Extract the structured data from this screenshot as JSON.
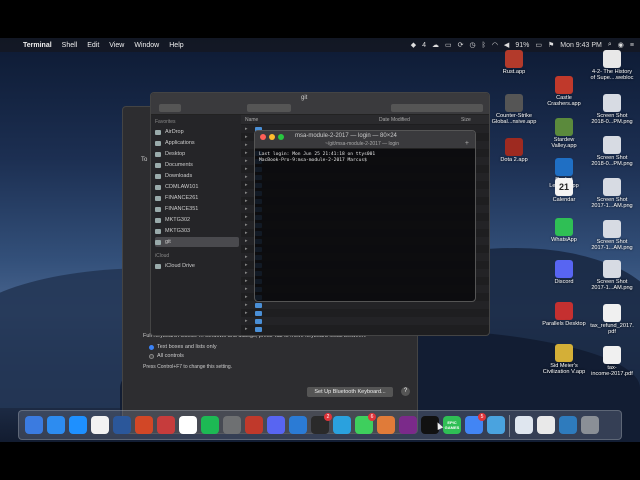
{
  "menubar": {
    "app": "Terminal",
    "items": [
      "Shell",
      "Edit",
      "View",
      "Window",
      "Help"
    ],
    "status": {
      "badge": "4",
      "battery": "91%",
      "clock": "Mon 9:43 PM"
    }
  },
  "finder": {
    "window_title": "git",
    "favorites_label": "Favorites",
    "sidebar": [
      "AirDrop",
      "Applications",
      "Desktop",
      "Documents",
      "Downloads",
      "CDMLAW101",
      "FINANCE261",
      "FINANCE351",
      "MKTG302",
      "MKTG303",
      "git"
    ],
    "icloud_label": "iCloud",
    "icloud_items": [
      "iCloud Drive"
    ],
    "columns": {
      "name": "Name",
      "date": "Date Modified",
      "size": "Size"
    }
  },
  "terminal": {
    "title": "msa-module-2-2017 — login — 80×24",
    "subtitle": "~/git/msa-module-2-2017 — login",
    "lines": [
      "Last login: Mon Jun 25 21:41:18 on ttys001",
      "MacBook-Pro-9:msa-module-2-2017 Marcus$ "
    ]
  },
  "keyboard_prefs": {
    "heading_fragment": "To",
    "full_keyboard_access": "Full Keyboard Access: In windows and dialogs, press Tab to move keyboard focus between:",
    "radio_text_boxes": "Text boxes and lists only",
    "radio_all_controls": "All controls",
    "hint": "Press Control+F7 to change this setting.",
    "bluetooth_button": "Set Up Bluetooth Keyboard...",
    "help_button": "?"
  },
  "desktop_icons": [
    {
      "label": "Rust.app",
      "color": "#b33a2b"
    },
    {
      "label": "4-2- The History\nof Supe....webloc",
      "color": "#e8e8e8"
    },
    {
      "label": "Castle\nCrashers.app",
      "color": "#c0392b"
    },
    {
      "label": "Counter-Strike\nGlobal...nsive.app",
      "color": "#555"
    },
    {
      "label": "Screen Shot\n2018-0...PM.png",
      "color": "#d7dbe3"
    },
    {
      "label": "Stardew\nValley.app",
      "color": "#5b8a3c"
    },
    {
      "label": "Dota 2.app",
      "color": "#9e2a20"
    },
    {
      "label": "Screen Shot\n2018-0...PM.png",
      "color": "#d7dbe3"
    },
    {
      "label": "Rocket\nLeague.app",
      "color": "#1f6fc4"
    },
    {
      "label": "Calendar",
      "color": "#f4f4f4"
    },
    {
      "label": "Screen Shot\n2017-1...AM.png",
      "color": "#d7dbe3"
    },
    {
      "label": "WhatsApp",
      "color": "#2fbf55"
    },
    {
      "label": "Screen Shot\n2017-1...AM.png",
      "color": "#d7dbe3"
    },
    {
      "label": "Discord",
      "color": "#5865f2"
    },
    {
      "label": "Screen Shot\n2017-1...AM.png",
      "color": "#d7dbe3"
    },
    {
      "label": "Parallels Desktop",
      "color": "#c53030"
    },
    {
      "label": "tax_refund_2017.\npdf",
      "color": "#f0f0f0"
    },
    {
      "label": "Sid Meier's\nCivilization V.app",
      "color": "#d4af37"
    },
    {
      "label": "tax-\nincome-2017.pdf",
      "color": "#f0f0f0"
    }
  ],
  "calendar_day": "21",
  "dock_badges": [
    "2",
    "6",
    "5"
  ],
  "dock_epic_label": "EPIC\nGAMES"
}
